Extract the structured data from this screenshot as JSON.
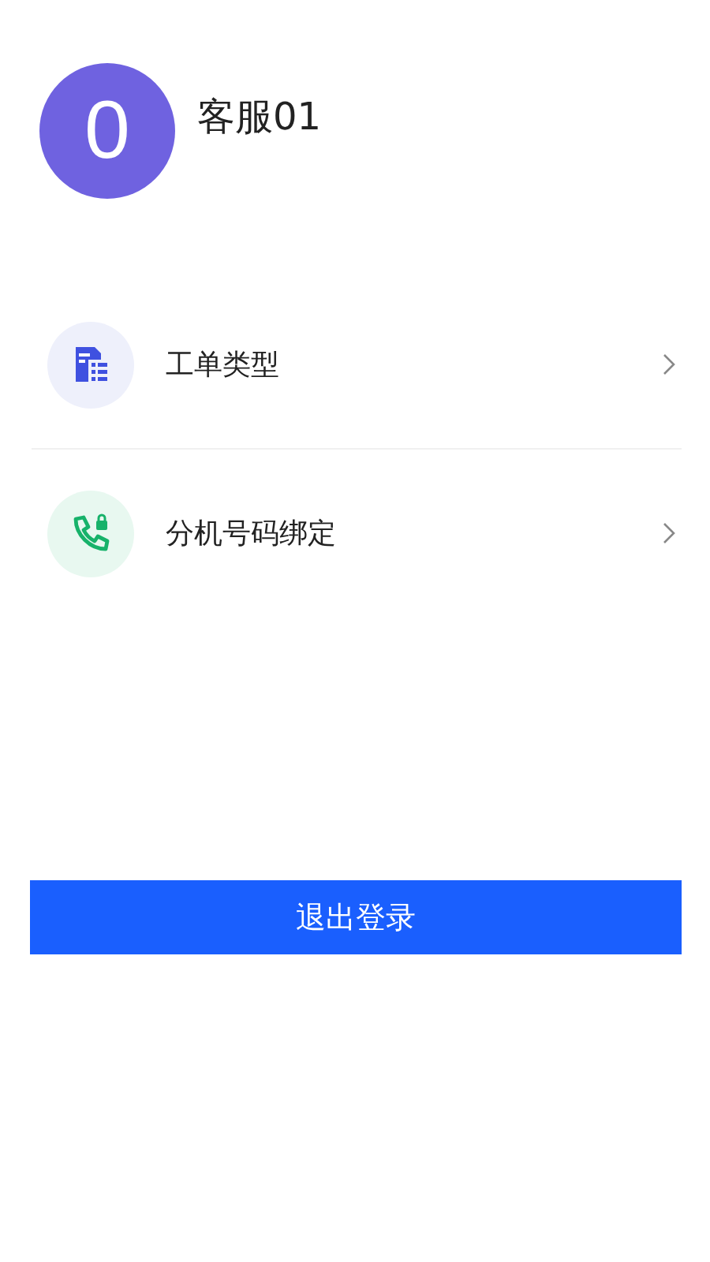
{
  "profile": {
    "avatar_text": "0",
    "name": "客服01"
  },
  "menu": [
    {
      "kind": "form",
      "label": "工单类型"
    },
    {
      "kind": "phone",
      "label": "分机号码绑定"
    }
  ],
  "logout_button": "退出登录"
}
